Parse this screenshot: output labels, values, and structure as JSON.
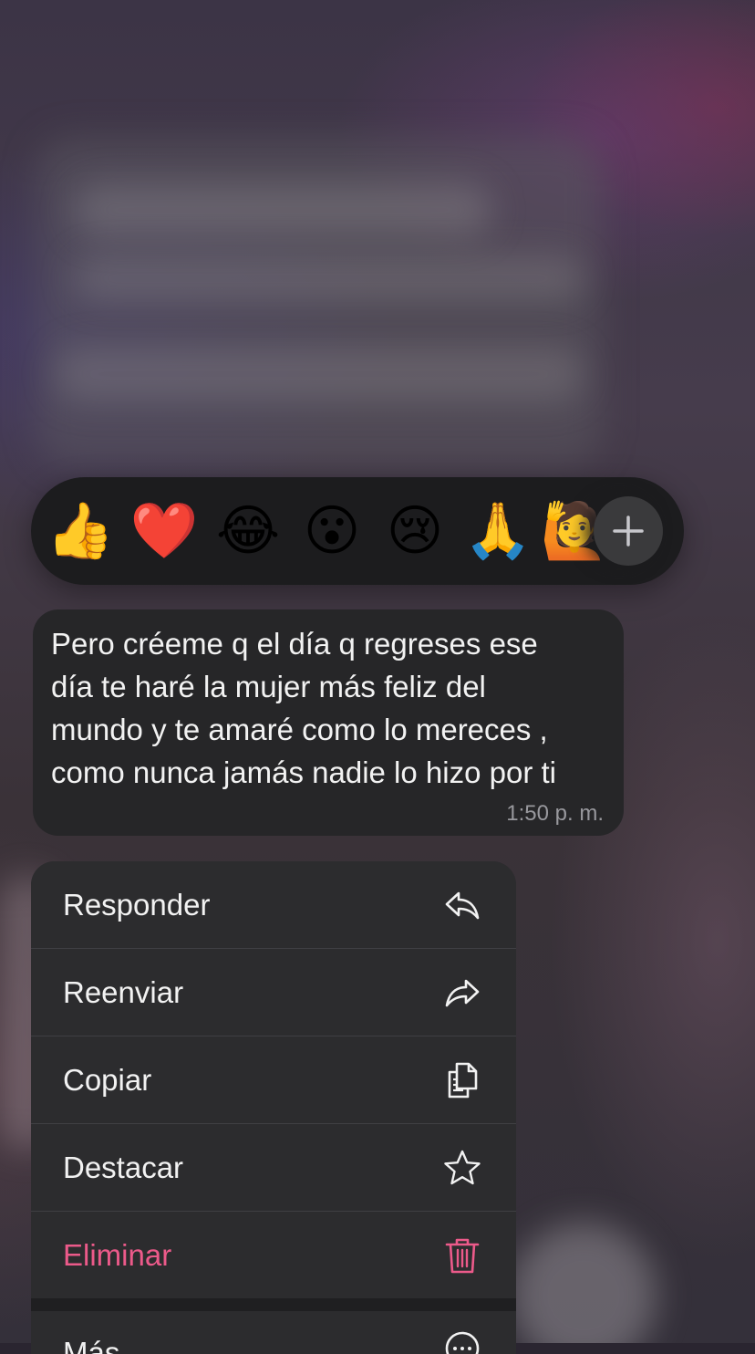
{
  "reactions": {
    "emojis": [
      {
        "name": "thumbs-up",
        "glyph": "👍"
      },
      {
        "name": "red-heart",
        "glyph": "❤️"
      },
      {
        "name": "tears-of-joy",
        "glyph": "😂"
      },
      {
        "name": "surprised",
        "glyph": "😮"
      },
      {
        "name": "crying",
        "glyph": "😢"
      },
      {
        "name": "folded-hands",
        "glyph": "🙏"
      },
      {
        "name": "raising-hand",
        "glyph": "🙋"
      }
    ],
    "add_icon": "plus-icon"
  },
  "message": {
    "text": "Pero créeme q el día q regreses ese\ndía te haré la mujer más feliz del\nmundo y te amaré como lo mereces ,\ncomo nunca jamás nadie lo hizo por ti",
    "time": "1:50 p. m."
  },
  "menu": {
    "items": [
      {
        "label": "Responder",
        "icon": "reply-icon"
      },
      {
        "label": "Reenviar",
        "icon": "forward-icon"
      },
      {
        "label": "Copiar",
        "icon": "copy-icon"
      },
      {
        "label": "Destacar",
        "icon": "star-icon"
      },
      {
        "label": "Eliminar",
        "icon": "trash-icon"
      },
      {
        "label": "Más...",
        "icon": "more-icon"
      }
    ]
  },
  "colors": {
    "danger": "#ec5a8a",
    "menu_bg": "#2c2c2e",
    "bubble_bg": "#262628"
  }
}
